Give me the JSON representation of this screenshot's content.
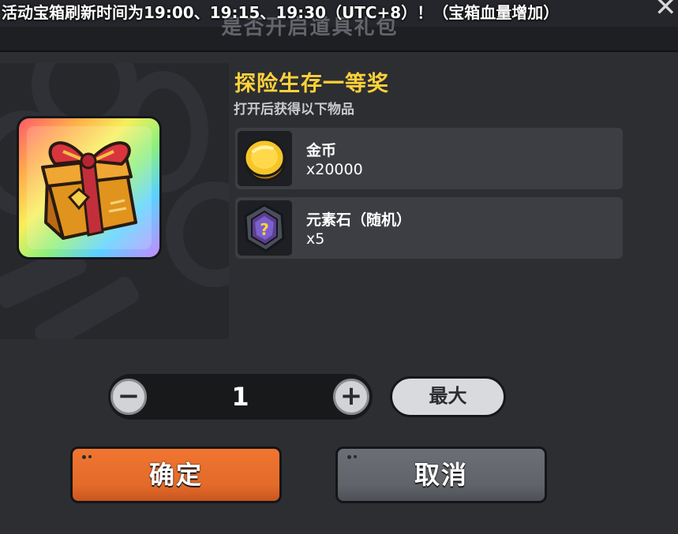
{
  "marquee": {
    "text": "活动宝箱刷新时间为19:00、19:15、19:30（UTC+8）！（宝箱血量增加）"
  },
  "dialog": {
    "title": "是否开启道具礼包",
    "close_icon": "close-icon"
  },
  "reward": {
    "name": "探险生存一等奖",
    "subtitle": "打开后获得以下物品",
    "items": [
      {
        "name": "金币",
        "quantity": "x20000",
        "icon": "gold-coin-icon"
      },
      {
        "name": "元素石（随机）",
        "quantity": "x5",
        "icon": "element-stone-icon"
      }
    ],
    "gift_icon": "rainbow-gift-box-icon"
  },
  "stepper": {
    "value": "1",
    "minus_icon": "minus-icon",
    "plus_icon": "plus-icon",
    "max_label": "最大"
  },
  "actions": {
    "confirm_label": "确定",
    "cancel_label": "取消"
  },
  "colors": {
    "accent_title": "#ffd23a",
    "confirm": "#e46a2a",
    "cancel": "#60636a",
    "panel": "#2d2e32"
  }
}
